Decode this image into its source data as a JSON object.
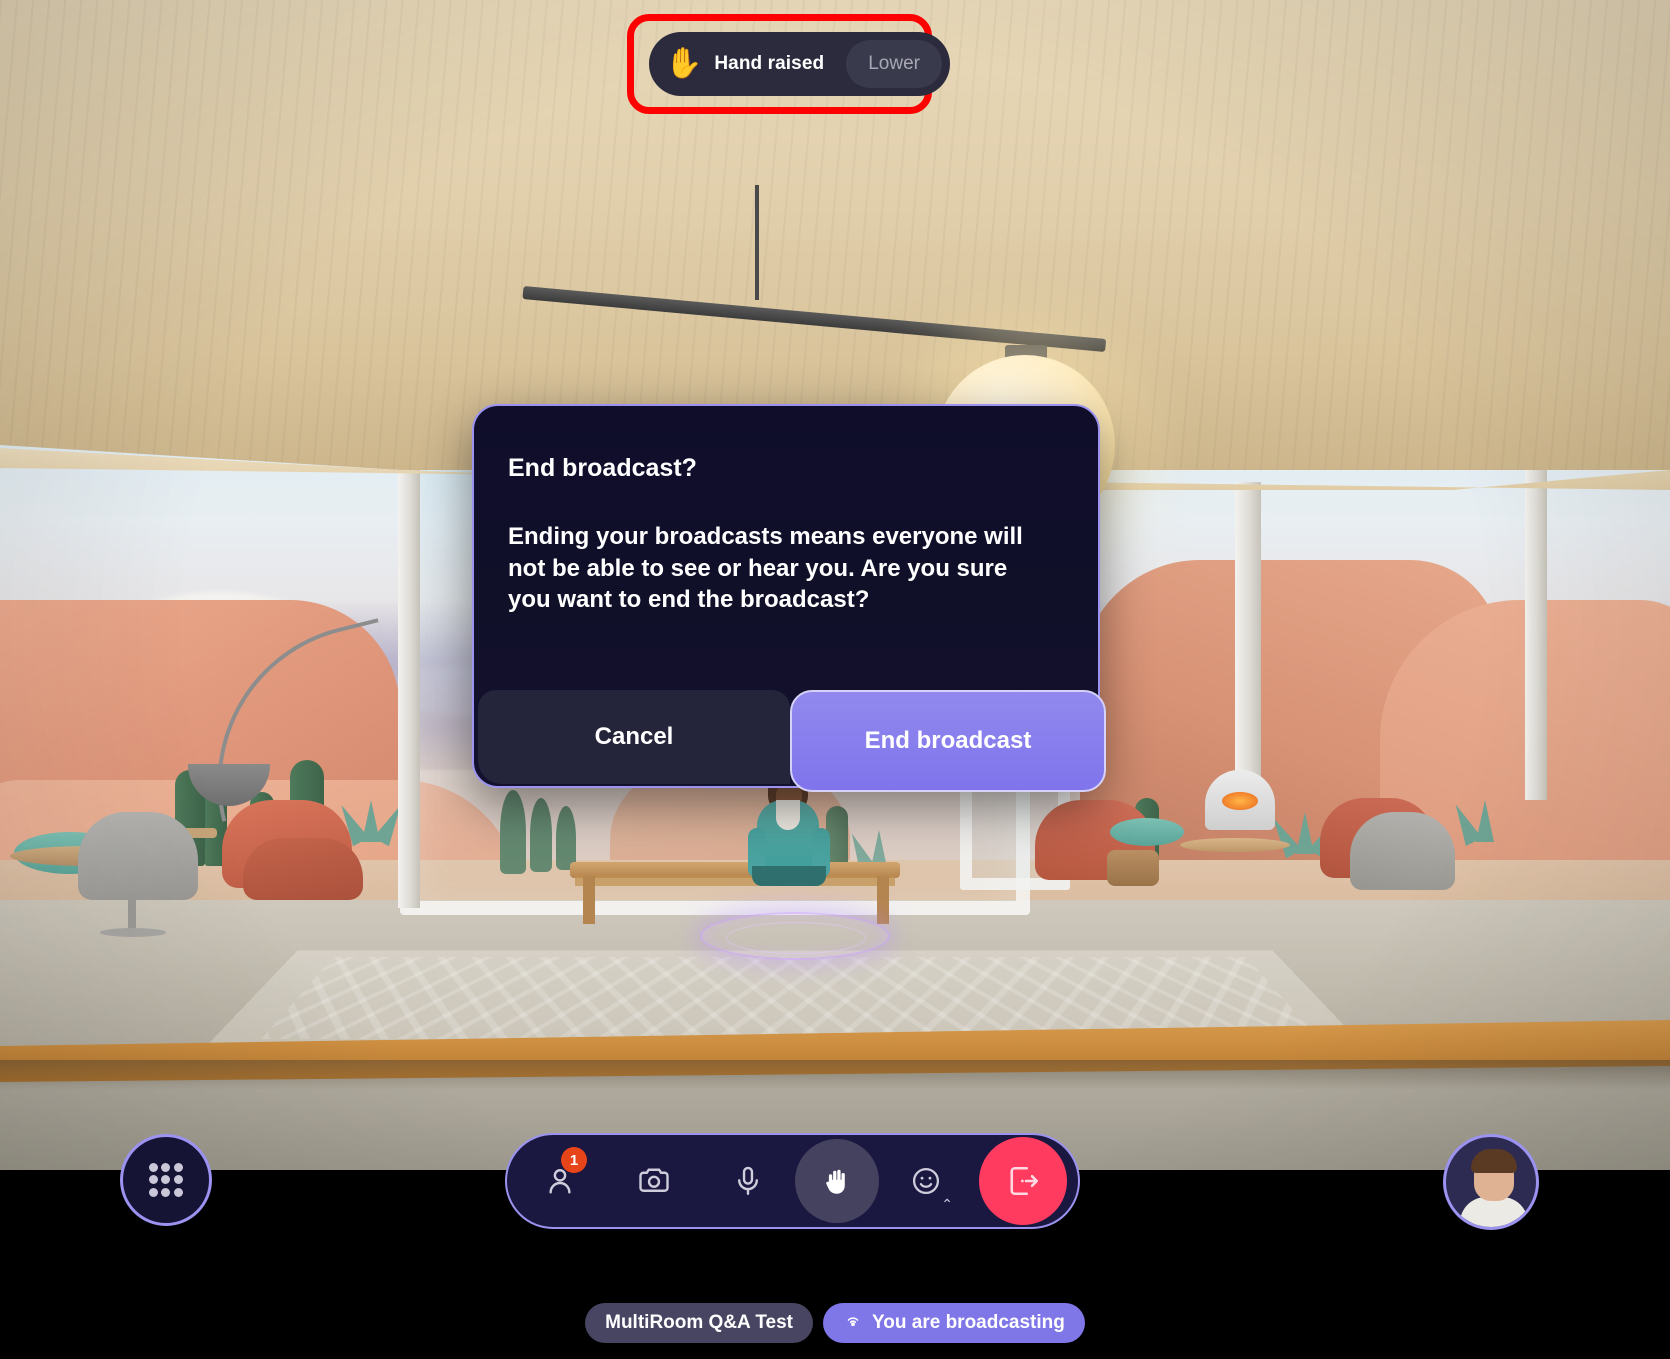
{
  "app": {
    "environment_name": "virtual-reality-workroom-desert-lounge"
  },
  "hand_banner": {
    "emoji": "✋",
    "emoji_name": "raised-hand-emoji",
    "status_label": "Hand raised",
    "lower_button_label": "Lower",
    "highlight_color": "#ff0000",
    "background_color": "#2b2b3d"
  },
  "dialog": {
    "title": "End broadcast?",
    "body": "Ending your broadcasts means everyone will not be able to see or hear you. Are you sure you want to end the broadcast?",
    "cancel_label": "Cancel",
    "confirm_label": "End broadcast",
    "border_color": "#9b93ef",
    "confirm_color": "#8279ee"
  },
  "bottom_bar": {
    "apps_button": {
      "icon": "grid-dots-icon",
      "accent_color": "#9b93ef"
    },
    "toolbar": [
      {
        "icon": "people-icon",
        "name": "participants",
        "badge": "1",
        "active": false
      },
      {
        "icon": "camera-icon",
        "name": "camera",
        "badge": "",
        "active": false
      },
      {
        "icon": "microphone-icon",
        "name": "microphone",
        "badge": "",
        "active": false
      },
      {
        "icon": "raised-hand-icon",
        "name": "raise-hand",
        "badge": "",
        "active": true
      },
      {
        "icon": "emoji-smiley-icon",
        "name": "reactions",
        "badge": "",
        "active": false,
        "chevron": "⌃"
      },
      {
        "icon": "leave-door-icon",
        "name": "leave-room",
        "badge": "",
        "active": false
      }
    ],
    "leave_color": "#ff3b60",
    "badge_color": "#e8441a",
    "avatar": {
      "name": "user-avatar",
      "ring_color": "#9b93ef"
    },
    "room_label": "MultiRoom Q&A Test",
    "broadcast_label": "You are broadcasting",
    "broadcast_icon": "broadcast-signal-icon",
    "broadcast_color": "#7f76e8"
  }
}
